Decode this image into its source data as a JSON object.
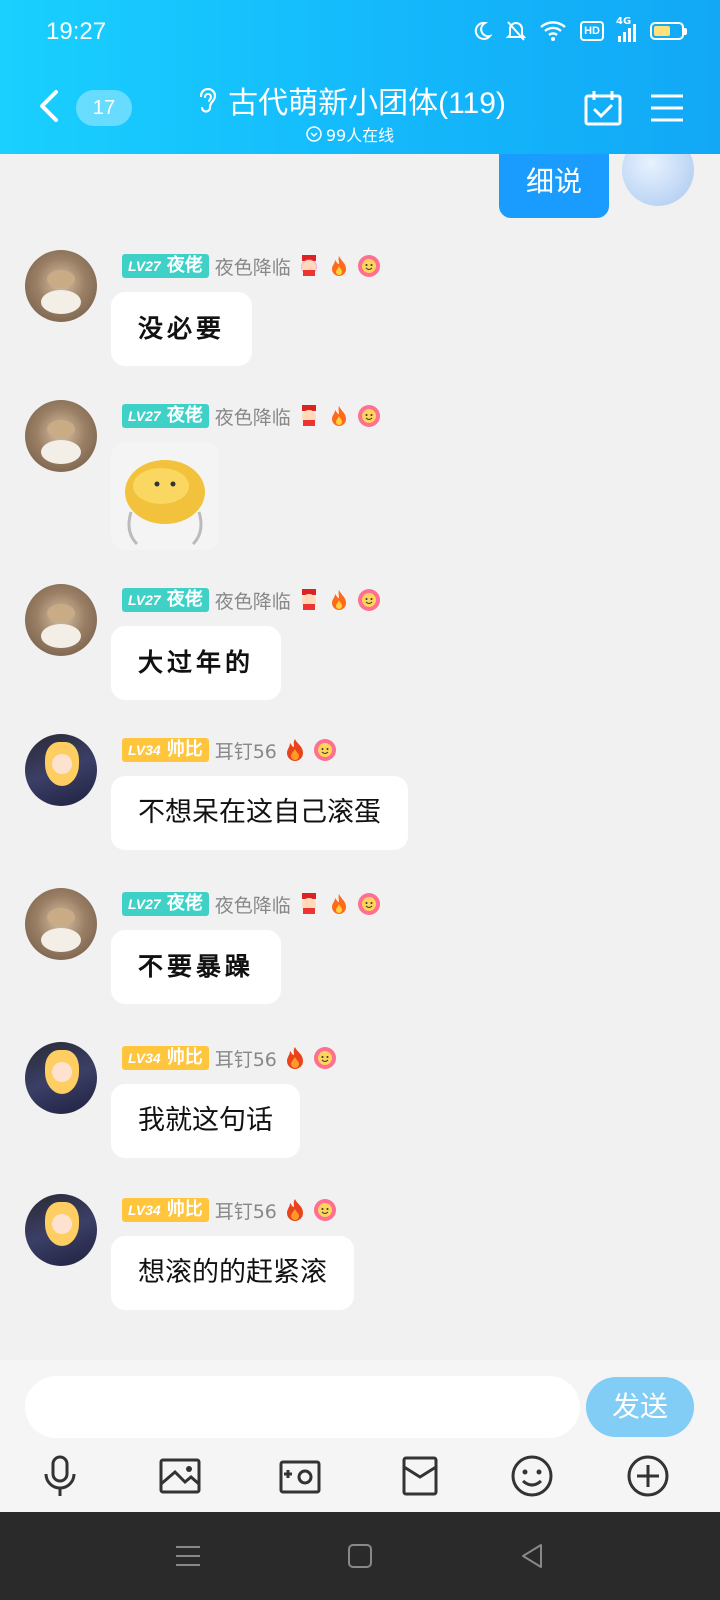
{
  "status_bar": {
    "time": "19:27",
    "network": "4G",
    "hd_label": "HD",
    "battery_percent": 60
  },
  "header": {
    "unread_count": "17",
    "group_name": "古代萌新小团体(119)",
    "online_count": "99人在线"
  },
  "colors": {
    "header_start": "#19d0ff",
    "header_end": "#12a8f6",
    "my_bubble": "#1a9cff",
    "send_button": "#81cdf6"
  },
  "my_message": {
    "text": "细说"
  },
  "messages": [
    {
      "user": "夜色降临",
      "title": "夜佬",
      "level": "LV27",
      "badge_color": "teal",
      "text": "没必要",
      "type": "text",
      "font": "hand"
    },
    {
      "user": "夜色降临",
      "title": "夜佬",
      "level": "LV27",
      "badge_color": "teal",
      "text": "",
      "type": "sticker",
      "sticker_icon": "yellow-blob-sticker"
    },
    {
      "user": "夜色降临",
      "title": "夜佬",
      "level": "LV27",
      "badge_color": "teal",
      "text": "大过年的",
      "type": "text",
      "font": "hand"
    },
    {
      "user": "耳钉56",
      "title": "帅比",
      "level": "LV34",
      "badge_color": "gold",
      "text": "不想呆在这自己滚蛋",
      "type": "text",
      "font": "normal"
    },
    {
      "user": "夜色降临",
      "title": "夜佬",
      "level": "LV27",
      "badge_color": "teal",
      "text": "不要暴躁",
      "type": "text",
      "font": "hand"
    },
    {
      "user": "耳钉56",
      "title": "帅比",
      "level": "LV34",
      "badge_color": "gold",
      "text": "我就这句话",
      "type": "text",
      "font": "normal"
    },
    {
      "user": "耳钉56",
      "title": "帅比",
      "level": "LV34",
      "badge_color": "gold",
      "text": "想滚的的赶紧滚",
      "type": "text",
      "font": "normal"
    }
  ],
  "input": {
    "placeholder": "",
    "value": "",
    "send_label": "发送"
  },
  "toolbar_icons": [
    "microphone-icon",
    "image-icon",
    "camera-icon",
    "red-packet-icon",
    "emoji-icon",
    "plus-icon"
  ],
  "nav_icons": [
    "menu-icon",
    "home-icon",
    "back-icon"
  ]
}
